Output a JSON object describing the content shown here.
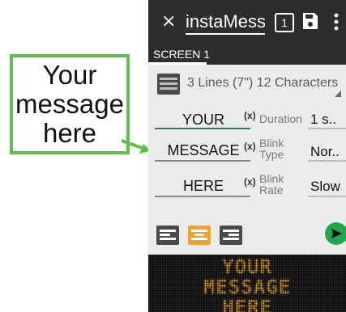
{
  "callout": {
    "text": "Your\nmessage\nhere"
  },
  "appbar": {
    "close_label": "×",
    "title": "instaMessage",
    "screen_count": "1",
    "tab_label": "SCREEN 1"
  },
  "sign": {
    "label": "3 Lines (7\") 12 Characters"
  },
  "lines": [
    {
      "text": "YOUR",
      "var_label": "(x)",
      "param_label": "Duration",
      "param_value": "1 s.."
    },
    {
      "text": "MESSAGE",
      "var_label": "(x)",
      "param_label": "Blink\nType",
      "param_value": "Nor.."
    },
    {
      "text": "HERE",
      "var_label": "(x)",
      "param_label": "Blink\nRate",
      "param_value": "Slow"
    }
  ],
  "display": {
    "lines": [
      "YOUR",
      "MESSAGE",
      "HERE"
    ]
  },
  "colors": {
    "appbar": "#2d2d2d",
    "accent_green": "#21a84b",
    "callout_border": "#5fbf4a",
    "align_active": "#f0a22a",
    "led_amber": "#e3a21a"
  },
  "icons": [
    "close-icon",
    "screen-count-icon",
    "save-icon",
    "more-icon",
    "sign-icon",
    "align-left-icon",
    "align-center-icon",
    "align-right-icon",
    "send-icon",
    "preview-icon",
    "arrow-icon"
  ]
}
